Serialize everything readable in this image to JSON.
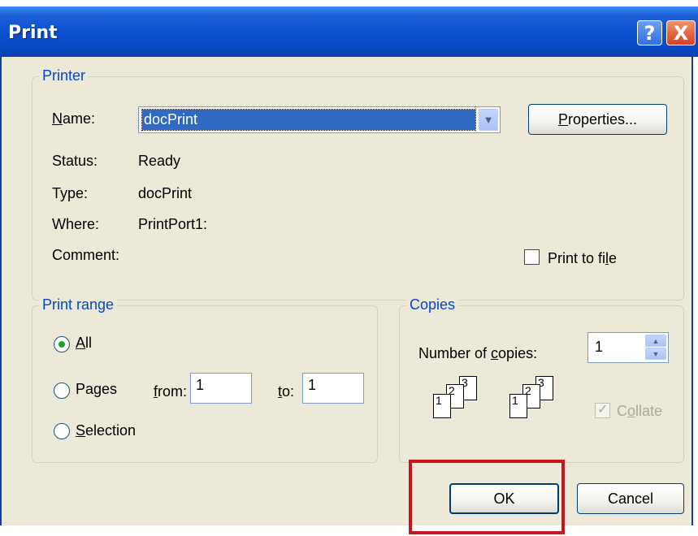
{
  "window": {
    "title": "Print",
    "help_glyph": "?",
    "close_glyph": "X"
  },
  "printer": {
    "legend": "Printer",
    "name_label": "Name:",
    "name_value": "docPrint",
    "properties_button": "Properties...",
    "status_label": "Status:",
    "status_value": "Ready",
    "type_label": "Type:",
    "type_value": "docPrint",
    "where_label": "Where:",
    "where_value": "PrintPort1:",
    "comment_label": "Comment:",
    "print_to_file_label": "Print to file",
    "print_to_file_checked": false
  },
  "print_range": {
    "legend": "Print range",
    "all_label": "All",
    "pages_label": "Pages",
    "selection_label": "Selection",
    "from_label": "from:",
    "from_value": "1",
    "to_label": "to:",
    "to_value": "1",
    "selected": "All"
  },
  "copies": {
    "legend": "Copies",
    "number_label": "Number of copies:",
    "number_value": "1",
    "collate_label": "Collate",
    "collate_checked": true,
    "collate_enabled": false,
    "page_numbers": [
      "1",
      "2",
      "3"
    ]
  },
  "buttons": {
    "ok": "OK",
    "cancel": "Cancel"
  },
  "colors": {
    "title_bar": "#0a4fd0",
    "dialog_bg": "#ece9d8",
    "group_legend": "#0046d5",
    "selection_highlight": "#316ac5",
    "annotation_box": "#c8141e"
  }
}
